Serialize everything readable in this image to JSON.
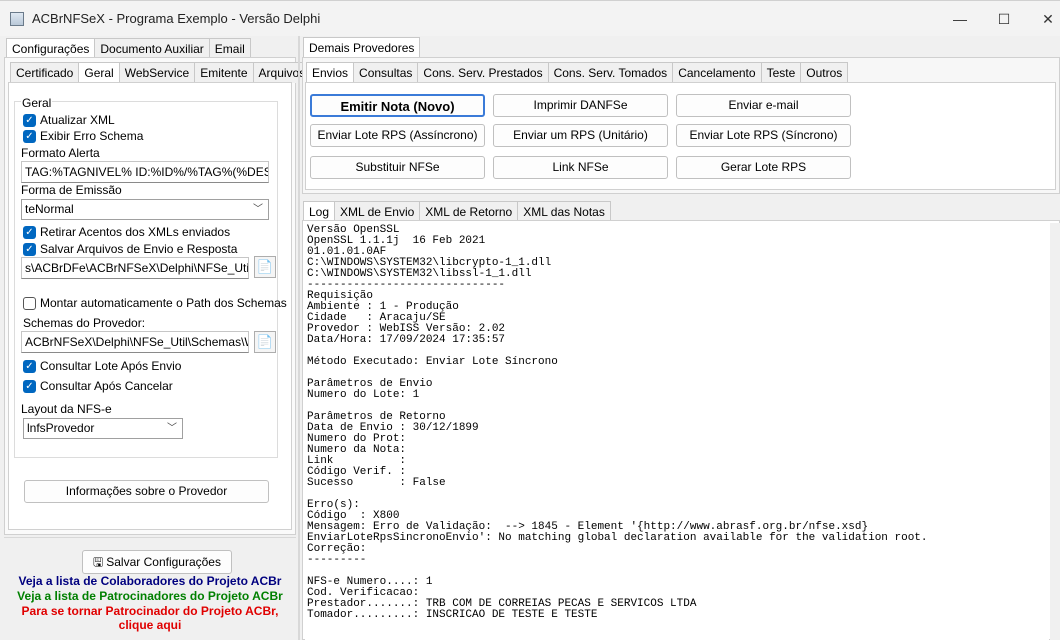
{
  "window": {
    "title": "ACBrNFSeX - Programa Exemplo - Versão Delphi",
    "minimize": "—",
    "maximize": "☐",
    "close": "✕"
  },
  "left": {
    "top_tabs": [
      "Configurações",
      "Documento Auxiliar",
      "Email"
    ],
    "sub_tabs": [
      "Certificado",
      "Geral",
      "WebService",
      "Emitente",
      "Arquivos"
    ],
    "group_title": "Geral",
    "cb_atualizar_xml": "Atualizar XML",
    "cb_exibir_erro": "Exibir Erro Schema",
    "formato_alerta_label": "Formato Alerta",
    "formato_alerta_value": "TAG:%TAGNIVEL% ID:%ID%/%TAG%(%DESCRI",
    "forma_emissao_label": "Forma de Emissão",
    "forma_emissao_value": "teNormal",
    "cb_retirar_acentos": "Retirar Acentos dos XMLs enviados",
    "cb_salvar_arquivos": "Salvar Arquivos de Envio e Resposta",
    "logs_path": "s\\ACBrDFe\\ACBrNFSeX\\Delphi\\NFSe_Util\\Logs",
    "cb_montar_path": "Montar automaticamente o Path dos Schemas",
    "schemas_label": "Schemas do Provedor:",
    "schemas_path": "ACBrNFSeX\\Delphi\\NFSe_Util\\Schemas\\WebISS",
    "cb_consultar_lote": "Consultar Lote Após Envio",
    "cb_consultar_cancelar": "Consultar Após Cancelar",
    "layout_label": "Layout da NFS-e",
    "layout_value": "lnfsProvedor",
    "info_provedor_button": "Informações sobre o Provedor",
    "salvar_config_button": "Salvar Configurações",
    "link_colaboradores": "Veja a lista de Colaboradores do Projeto ACBr",
    "link_patrocinadores": "Veja a lista de Patrocinadores do Projeto ACBr",
    "link_patrocinador_1": "Para se tornar Patrocinador do Projeto ACBr,",
    "link_patrocinador_2": "clique aqui",
    "colors": {
      "blue_link": "#00007f",
      "green_link": "#008000",
      "red_link": "#e00000"
    }
  },
  "right": {
    "top_tab": "Demais Provedores",
    "action_tabs": [
      "Envios",
      "Consultas",
      "Cons. Serv. Prestados",
      "Cons. Serv. Tomados",
      "Cancelamento",
      "Teste",
      "Outros"
    ],
    "buttons": {
      "emitir_nota": "Emitir Nota (Novo)",
      "imprimir_danfse": "Imprimir DANFSe",
      "enviar_email": "Enviar e-mail",
      "enviar_lote_assincrono": "Enviar Lote RPS (Assíncrono)",
      "enviar_um_rps": "Enviar um RPS (Unitário)",
      "enviar_lote_sincrono": "Enviar Lote RPS (Síncrono)",
      "substituir_nfse": "Substituir NFSe",
      "link_nfse": "Link NFSe",
      "gerar_lote_rps": "Gerar Lote RPS"
    },
    "log_tabs": [
      "Log",
      "XML de Envio",
      "XML de Retorno",
      "XML das Notas"
    ],
    "log_text": "Versão OpenSSL\nOpenSSL 1.1.1j  16 Feb 2021\n01.01.01.0AF\nC:\\WINDOWS\\SYSTEM32\\libcrypto-1_1.dll\nC:\\WINDOWS\\SYSTEM32\\libssl-1_1.dll\n------------------------------\nRequisição\nAmbiente : 1 - Produção\nCidade   : Aracaju/SE\nProvedor : WebISS Versão: 2.02\nData/Hora: 17/09/2024 17:35:57\n\nMétodo Executado: Enviar Lote Síncrono\n\nParâmetros de Envio\nNumero do Lote: 1\n\nParâmetros de Retorno\nData de Envio : 30/12/1899\nNumero do Prot:\nNumero da Nota:\nLink          :\nCódigo Verif. :\nSucesso       : False\n\nErro(s):\nCódigo  : X800\nMensagem: Erro de Validação:  --> 1845 - Element '{http://www.abrasf.org.br/nfse.xsd}\nEnviarLoteRpsSincronoEnvio': No matching global declaration available for the validation root.\nCorreção:\n---------\n\nNFS-e Numero....: 1\nCod. Verificacao:\nPrestador.......: TRB COM DE CORREIAS PECAS E SERVICOS LTDA\nTomador.........: INSCRICAO DE TESTE E TESTE"
  }
}
